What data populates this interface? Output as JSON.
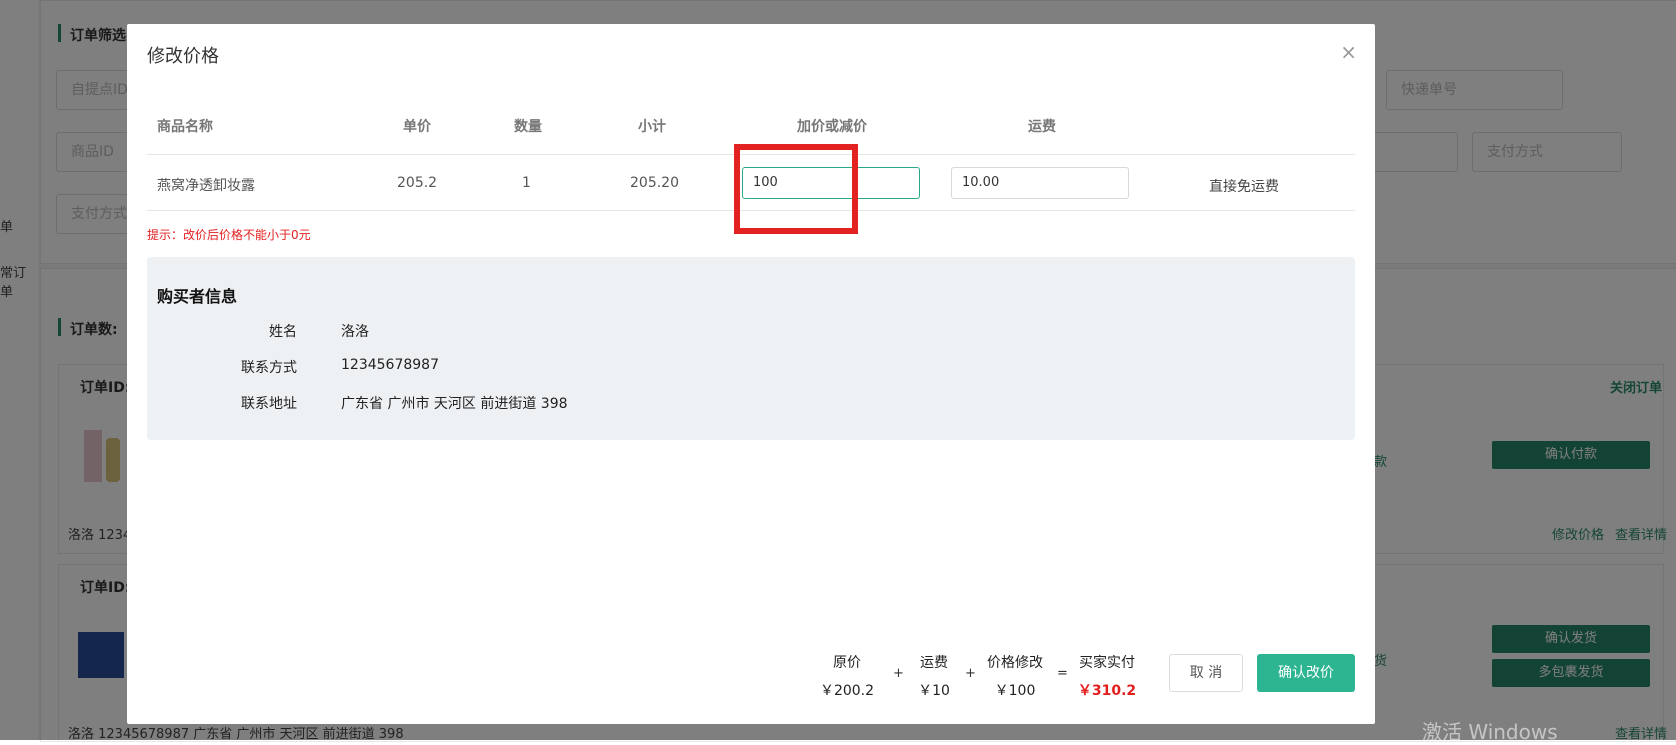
{
  "background": {
    "left_nav": [
      "单",
      "常订单"
    ],
    "filter_title": "订单筛选",
    "filter_fields": {
      "pickup_id": "自提点ID",
      "product_id": "商品ID",
      "pay_method_1": "支付方式",
      "tracking_no": "快递单号",
      "pay_method_2": "支付方式"
    },
    "order_count_label": "订单数:",
    "order_id_label": "订单ID:",
    "close_order": "关闭订单",
    "confirm_payment": "确认付款",
    "confirm_shipment": "确认发货",
    "multi_package": "多包裹发货",
    "modify_price_link": "修改价格",
    "view_details": "查看详情",
    "status_1": "款",
    "status_2": "货",
    "row1_buyer": "洛洛  1234",
    "row2_buyer": "洛洛  12345678987  广东省 广州市 天河区 前进街道 398",
    "watermark": "激活 Windows"
  },
  "modal": {
    "title": "修改价格",
    "close_symbol": "×",
    "table": {
      "headers": [
        "商品名称",
        "单价",
        "数量",
        "小计",
        "加价或减价",
        "运费"
      ],
      "row": {
        "product_name": "燕窝净透卸妆露",
        "unit_price": "205.2",
        "quantity": "1",
        "subtotal": "205.20",
        "adjustment": "100",
        "shipping": "10.00",
        "free_shipping_link": "直接免运费"
      }
    },
    "tip": "提示：改价后价格不能小于0元",
    "buyer": {
      "title": "购买者信息",
      "name_label": "姓名",
      "name": "洛洛",
      "contact_label": "联系方式",
      "contact": "12345678987",
      "address_label": "联系地址",
      "address": "广东省 广州市 天河区 前进街道 398"
    },
    "summary": {
      "original_label": "原价",
      "original": "￥200.2",
      "plus1": "+",
      "shipping_label": "运费",
      "shipping": "￥10",
      "plus2": "+",
      "modify_label": "价格修改",
      "modify": "￥100",
      "equals": "=",
      "paid_label": "买家实付",
      "paid": "￥310.2"
    },
    "cancel_label": "取 消",
    "confirm_label": "确认改价"
  },
  "colors": {
    "accent": "#2db592",
    "danger": "#e31e1e",
    "highlight_box": "#e32222"
  }
}
